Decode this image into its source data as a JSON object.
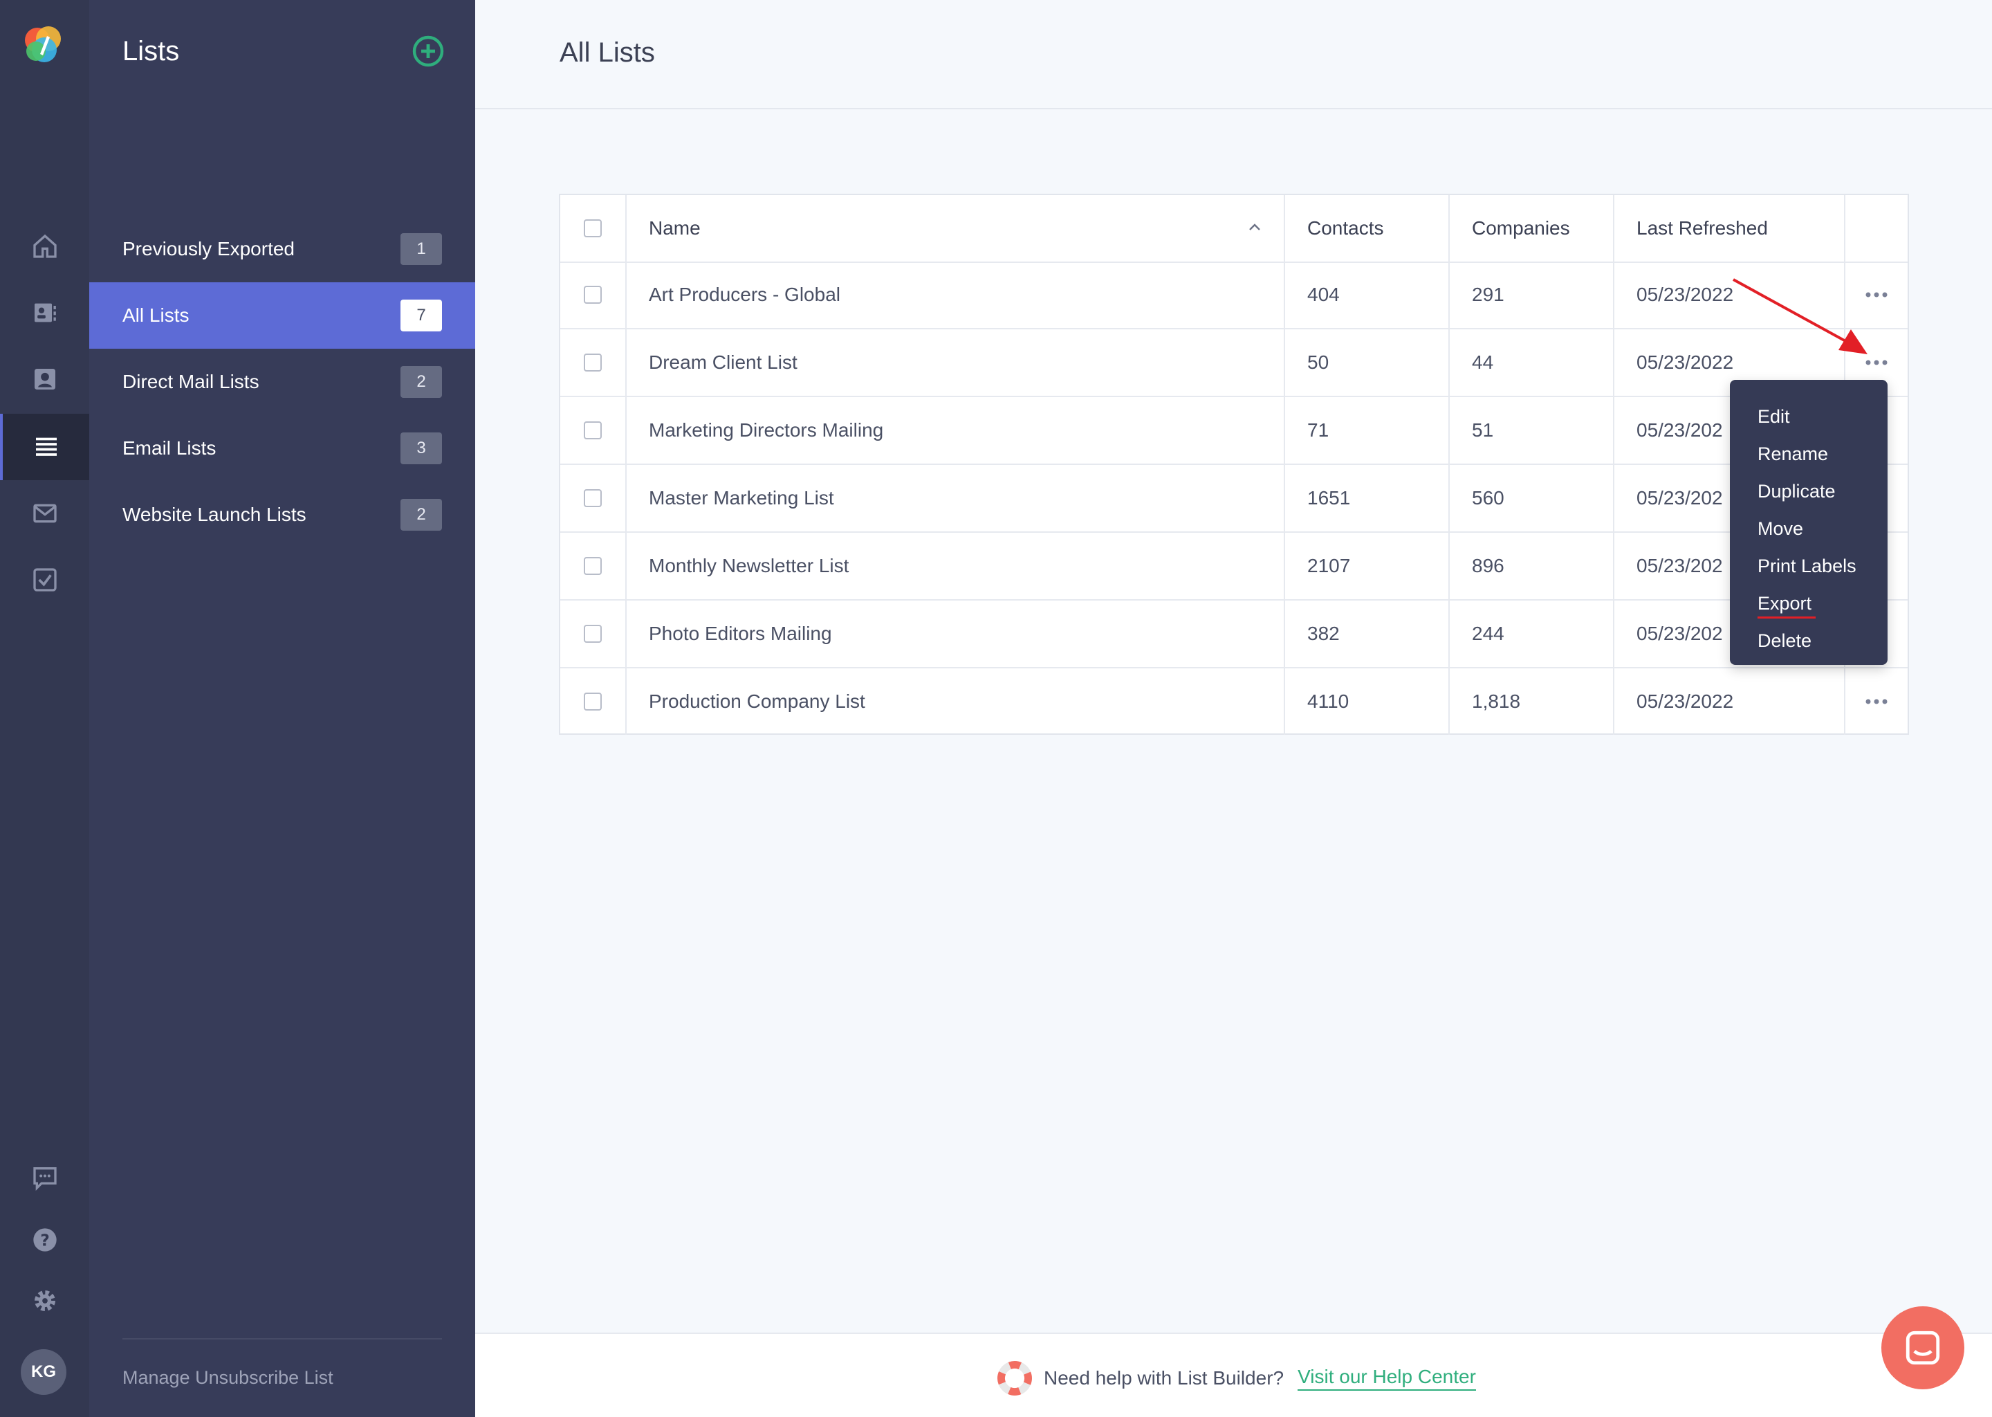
{
  "sidebar": {
    "title": "Lists",
    "avatar_initials": "KG",
    "manage_link": "Manage Unsubscribe List",
    "items": [
      {
        "label": "Previously Exported",
        "count": "1"
      },
      {
        "label": "All Lists",
        "count": "7"
      },
      {
        "label": "Direct Mail Lists",
        "count": "2"
      },
      {
        "label": "Email Lists",
        "count": "3"
      },
      {
        "label": "Website Launch Lists",
        "count": "2"
      }
    ]
  },
  "main": {
    "title": "All Lists",
    "columns": {
      "name": "Name",
      "contacts": "Contacts",
      "companies": "Companies",
      "last_refreshed": "Last Refreshed"
    },
    "rows": [
      {
        "name": "Art Producers - Global",
        "contacts": "404",
        "companies": "291",
        "last_refreshed": "05/23/2022"
      },
      {
        "name": "Dream Client List",
        "contacts": "50",
        "companies": "44",
        "last_refreshed": "05/23/2022"
      },
      {
        "name": "Marketing Directors Mailing",
        "contacts": "71",
        "companies": "51",
        "last_refreshed": "05/23/202"
      },
      {
        "name": "Master Marketing List",
        "contacts": "1651",
        "companies": "560",
        "last_refreshed": "05/23/202"
      },
      {
        "name": "Monthly Newsletter List",
        "contacts": "2107",
        "companies": "896",
        "last_refreshed": "05/23/202"
      },
      {
        "name": "Photo Editors Mailing",
        "contacts": "382",
        "companies": "244",
        "last_refreshed": "05/23/202"
      },
      {
        "name": "Production Company List",
        "contacts": "4110",
        "companies": "1,818",
        "last_refreshed": "05/23/2022"
      }
    ]
  },
  "context_menu": {
    "items": [
      "Edit",
      "Rename",
      "Duplicate",
      "Move",
      "Print Labels",
      "Export",
      "Delete"
    ]
  },
  "footer": {
    "question": "Need help with List Builder?",
    "link": "Visit our Help Center"
  },
  "colors": {
    "accent": "#5d6bd6",
    "sidebar": "#373c59",
    "rail": "#333851",
    "link_green": "#2fae7d",
    "annotation_red": "#e21f26",
    "chat": "#f26e62"
  },
  "icons": {
    "rail": [
      "home-icon",
      "contacts-icon",
      "profile-icon",
      "lists-icon",
      "mail-icon",
      "tasks-icon",
      "feedback-icon",
      "help-icon",
      "settings-icon"
    ]
  }
}
